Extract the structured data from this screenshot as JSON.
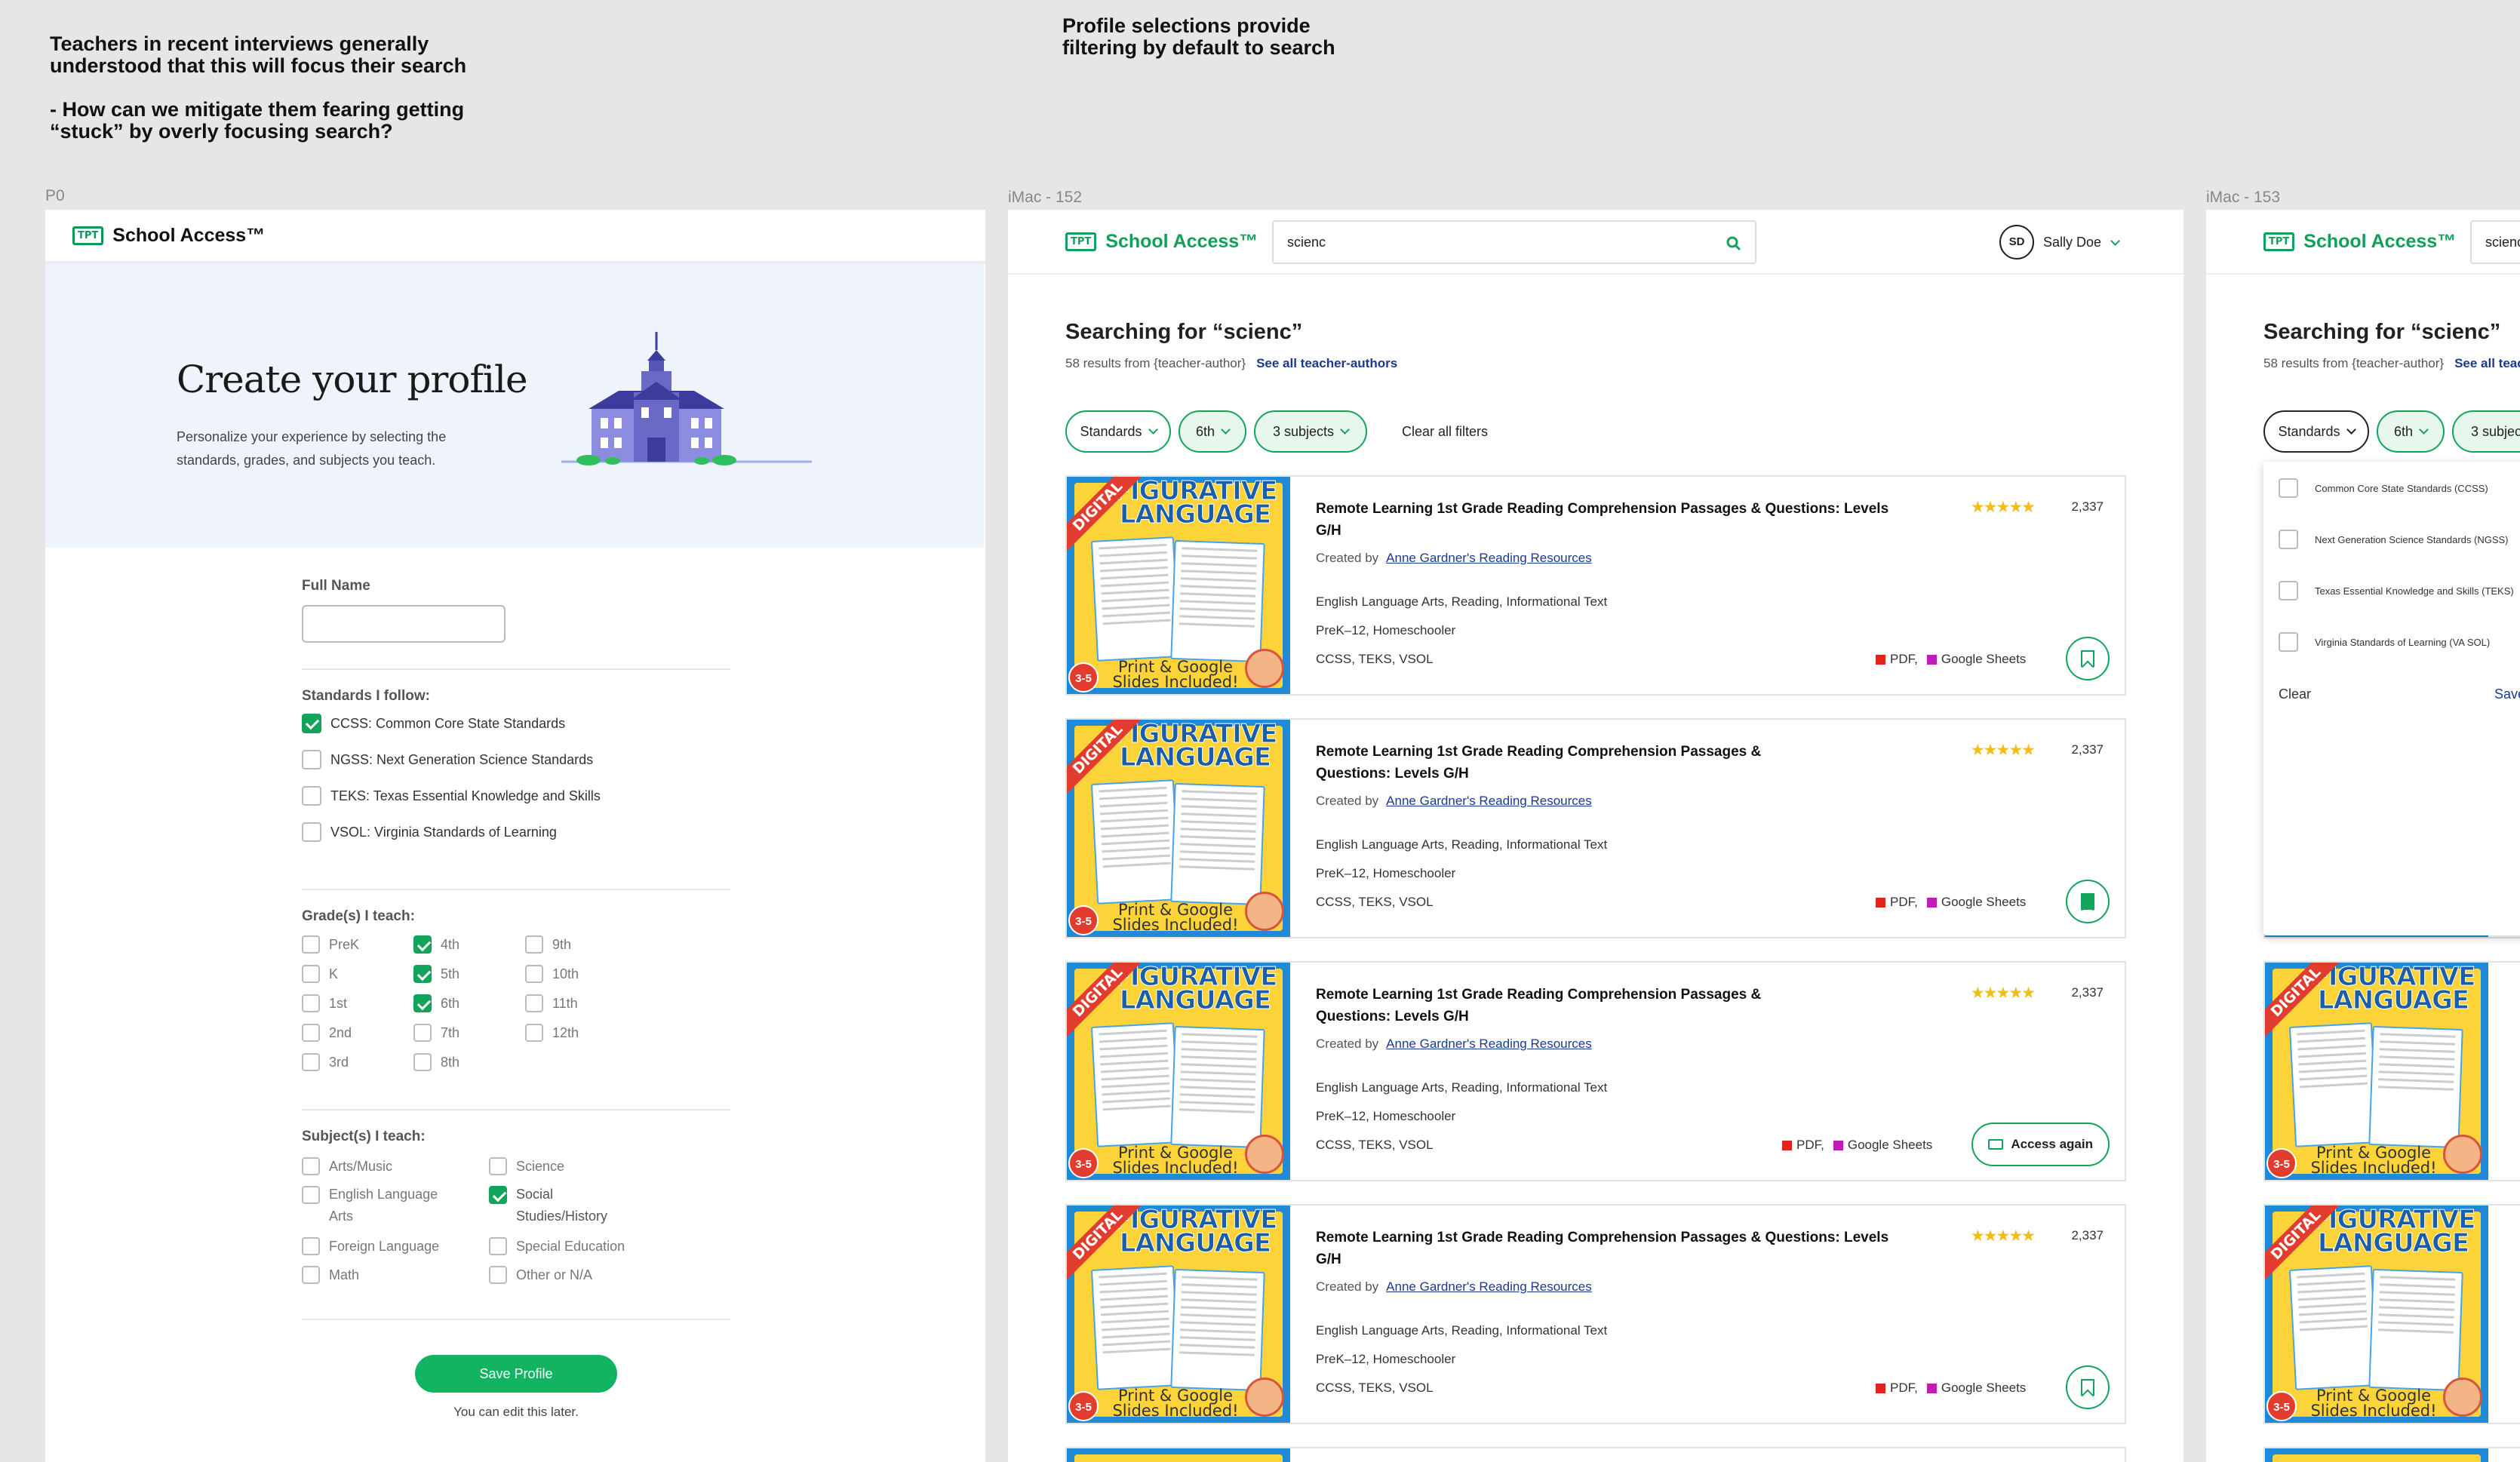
{
  "notes": {
    "left": "Teachers in recent interviews generally\nunderstood that this will focus their search\n\n- How can we mitigate them fearing getting\n“stuck” by overly focusing search?",
    "center": "Profile selections provide\nfiltering by default to search"
  },
  "frame_labels": [
    "P0",
    "iMac - 152",
    "iMac - 153"
  ],
  "brand": {
    "badge": "TPT",
    "name": "School Access™",
    "accent": "#12a45b"
  },
  "profile": {
    "title": "Create your profile",
    "subtitle": "Personalize your experience by selecting the standards, grades, and subjects you teach.",
    "full_name_label": "Full Name",
    "full_name_value": "",
    "standards_label": "Standards I follow:",
    "standards": [
      {
        "label": "CCSS: Common Core State Standards",
        "checked": true
      },
      {
        "label": "NGSS: Next Generation Science Standards",
        "checked": false
      },
      {
        "label": "TEKS: Texas Essential Knowledge and Skills",
        "checked": false
      },
      {
        "label": "VSOL: Virginia Standards of Learning",
        "checked": false
      }
    ],
    "grades_label": "Grade(s) I teach:",
    "grades": [
      {
        "label": "PreK",
        "checked": false
      },
      {
        "label": "K",
        "checked": false
      },
      {
        "label": "1st",
        "checked": false
      },
      {
        "label": "2nd",
        "checked": false
      },
      {
        "label": "3rd",
        "checked": false
      },
      {
        "label": "4th",
        "checked": true
      },
      {
        "label": "5th",
        "checked": true
      },
      {
        "label": "6th",
        "checked": true
      },
      {
        "label": "7th",
        "checked": false
      },
      {
        "label": "8th",
        "checked": false
      },
      {
        "label": "9th",
        "checked": false
      },
      {
        "label": "10th",
        "checked": false
      },
      {
        "label": "11th",
        "checked": false
      },
      {
        "label": "12th",
        "checked": false
      }
    ],
    "subjects_label": "Subject(s) I teach:",
    "subjects": [
      {
        "label": "Arts/Music",
        "checked": false
      },
      {
        "label": "English Language Arts",
        "checked": false
      },
      {
        "label": "Foreign Language",
        "checked": false
      },
      {
        "label": "Math",
        "checked": false
      },
      {
        "label": "Science",
        "checked": false
      },
      {
        "label": "Social Studies/History",
        "checked": true
      },
      {
        "label": "Special Education",
        "checked": false
      },
      {
        "label": "Other or N/A",
        "checked": false
      }
    ],
    "save_label": "Save Profile",
    "edit_hint": "You can edit this later."
  },
  "search": {
    "query": "scienc",
    "heading": "Searching for “scienc”",
    "results_text": "58 results from {teacher-author}",
    "see_all": "See all teacher-authors",
    "user_initials": "SD",
    "user_name": "Sally Doe",
    "filters": {
      "standards": "Standards",
      "grade": "6th",
      "subjects": "3 subjects",
      "clear": "Clear all filters"
    }
  },
  "resource_cover": {
    "banner": "DIGITAL",
    "title": "FIGURATIVE LANGUAGE",
    "subtitle": "Print & Google Slides Included!",
    "grade": "3-5"
  },
  "cards": [
    {
      "title": "Remote Learning 1st Grade Reading Comprehension Passages & Questions: Levels G/H",
      "stars": "★★★★★",
      "rating_count": "2,337",
      "created_by": "Created by",
      "author": "Anne Gardner's Reading Resources",
      "subjects": "English Language Arts, Reading, Informational Text",
      "grades": "PreK–12, Homeschooler",
      "standards": "CCSS, TEKS, VSOL",
      "format1": "PDF,",
      "format2": "Google Sheets",
      "action": "bookmark"
    },
    {
      "title": "Remote Learning 1st Grade Reading Comprehension Passages & Questions: Levels G/H",
      "stars": "★★★★★",
      "rating_count": "2,337",
      "created_by": "Created by",
      "author": "Anne Gardner's Reading Resources",
      "subjects": "English Language Arts, Reading, Informational Text",
      "grades": "PreK–12, Homeschooler",
      "standards": "CCSS, TEKS, VSOL",
      "format1": "PDF,",
      "format2": "Google Sheets",
      "action": "bookmarked"
    },
    {
      "title": "Remote Learning 1st Grade Reading Comprehension Passages & Questions: Levels G/H",
      "stars": "★★★★★",
      "rating_count": "2,337",
      "created_by": "Created by",
      "author": "Anne Gardner's Reading Resources",
      "subjects": "English Language Arts, Reading, Informational Text",
      "grades": "PreK–12, Homeschooler",
      "standards": "CCSS, TEKS, VSOL",
      "format1": "PDF,",
      "format2": "Google Sheets",
      "action": "Access again"
    },
    {
      "title": "Remote Learning 1st Grade Reading Comprehension Passages & Questions: Levels G/H",
      "stars": "★★★★★",
      "rating_count": "2,337",
      "created_by": "Created by",
      "author": "Anne Gardner's Reading Resources",
      "subjects": "English Language Arts, Reading, Informational Text",
      "grades": "PreK–12, Homeschooler",
      "standards": "CCSS, TEKS, VSOL",
      "format1": "PDF,",
      "format2": "Google Sheets",
      "action": "bookmark"
    }
  ],
  "dropdown": {
    "options": [
      "Common Core State Standards (CCSS)",
      "Next Generation Science Standards (NGSS)",
      "Texas Essential Knowledge and Skills (TEKS)",
      "Virginia Standards of Learning (VA SOL)"
    ],
    "clear": "Clear",
    "save": "Save"
  },
  "colors": {
    "pdf": "#e0241b",
    "sheets": "#c21cb8",
    "accent": "#12a45b",
    "link": "#1b3a8f"
  }
}
